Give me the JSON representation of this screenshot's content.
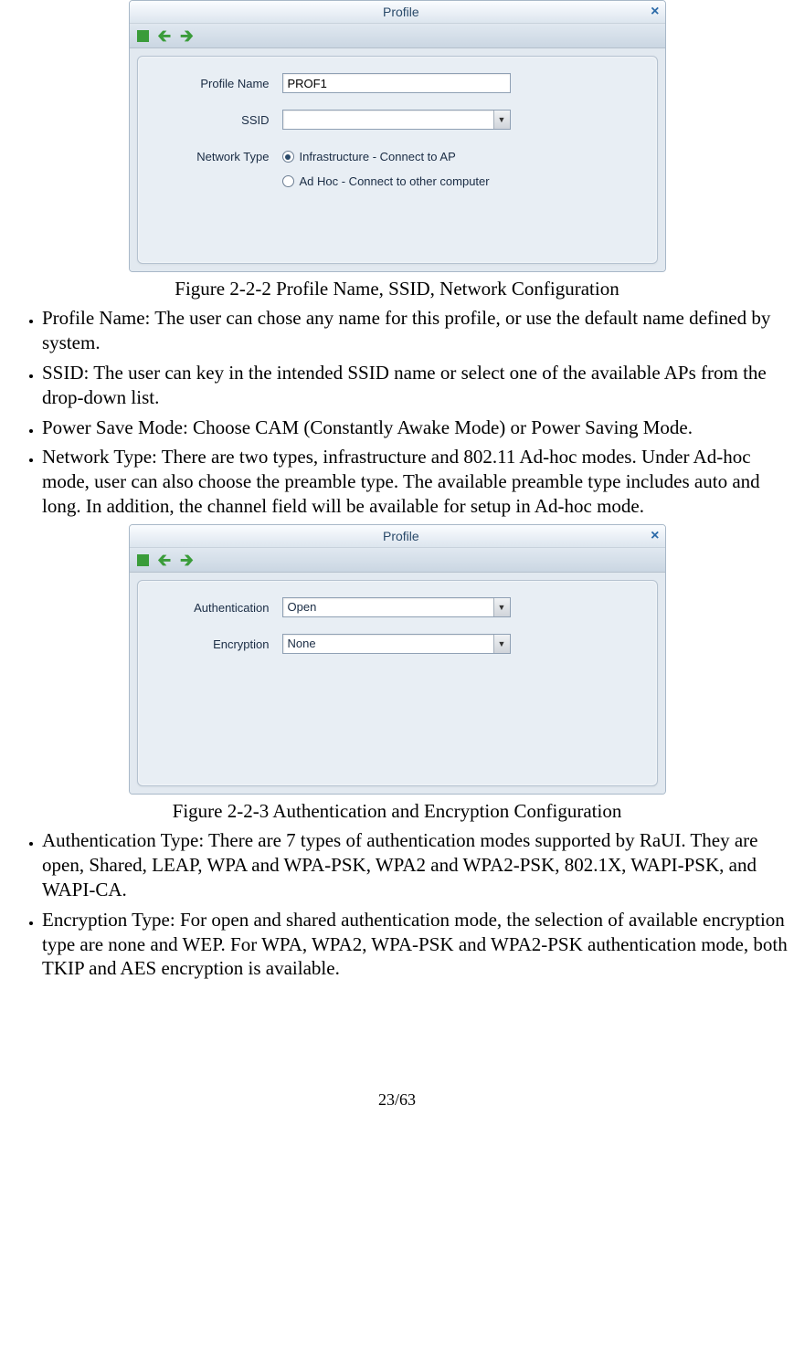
{
  "dialog1": {
    "title": "Profile",
    "profileName": {
      "label": "Profile Name",
      "value": "PROF1"
    },
    "ssid": {
      "label": "SSID",
      "value": ""
    },
    "networkType": {
      "label": "Network Type",
      "options": [
        {
          "label": "Infrastructure - Connect to AP",
          "selected": true
        },
        {
          "label": "Ad Hoc - Connect to other computer",
          "selected": false
        }
      ]
    }
  },
  "caption1": "Figure 2-2-2 Profile Name, SSID, Network Configuration",
  "bullets1": [
    "Profile Name: The user can chose any name for this profile, or use the default name defined by system.",
    "SSID: The user can key in the intended SSID name or select one of the available APs from the drop-down list.",
    "Power Save Mode: Choose CAM (Constantly Awake Mode) or Power Saving Mode.",
    "Network Type: There are two types, infrastructure and 802.11 Ad-hoc modes. Under Ad-hoc mode, user can also choose the preamble type. The available preamble type includes auto and long. In addition, the channel field will be available for setup in Ad-hoc mode."
  ],
  "dialog2": {
    "title": "Profile",
    "auth": {
      "label": "Authentication",
      "value": "Open"
    },
    "encr": {
      "label": "Encryption",
      "value": "None"
    }
  },
  "caption2": "Figure 2-2-3 Authentication and Encryption Configuration",
  "bullets2": [
    "Authentication Type: There are 7 types of authentication modes supported by RaUI. They are open, Shared, LEAP, WPA and WPA-PSK, WPA2 and WPA2-PSK, 802.1X, WAPI-PSK, and WAPI-CA.",
    "Encryption Type: For open and shared authentication mode, the selection of available encryption type are none and WEP. For WPA, WPA2, WPA-PSK and WPA2-PSK authentication mode, both TKIP and AES encryption is available."
  ],
  "pageNumber": "23/63"
}
